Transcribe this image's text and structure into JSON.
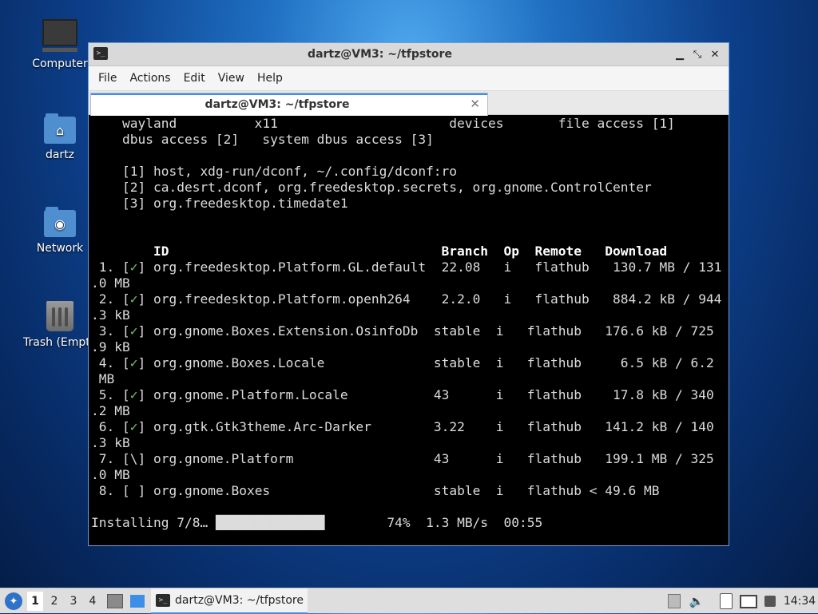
{
  "desktop": {
    "icons": [
      {
        "label": "Computer"
      },
      {
        "label": "dartz"
      },
      {
        "label": "Network"
      },
      {
        "label": "Trash (Empty)"
      }
    ]
  },
  "window": {
    "title": "dartz@VM3: ~/tfpstore",
    "controls": {
      "minimize": "▁",
      "maximize": "⤡",
      "close": "✕"
    },
    "menu": [
      "File",
      "Actions",
      "Edit",
      "View",
      "Help"
    ],
    "tab": {
      "label": "dartz@VM3: ~/tfpstore",
      "close": "✕"
    }
  },
  "terminal": {
    "permissions": [
      "    wayland          x11                      devices       file access [1]",
      "    dbus access [2]   system dbus access [3]"
    ],
    "notes": [
      "    [1] host, xdg-run/dconf, ~/.config/dconf:ro",
      "    [2] ca.desrt.dconf, org.freedesktop.secrets, org.gnome.ControlCenter",
      "    [3] org.freedesktop.timedate1"
    ],
    "header": "        ID                                   Branch  Op  Remote   Download",
    "rows": [
      {
        "num": " 1.",
        "mark": "✓",
        "rest": " org.freedesktop.Platform.GL.default  22.08   i   flathub   130.7 MB / 131",
        "wrap": ".0 MB"
      },
      {
        "num": " 2.",
        "mark": "✓",
        "rest": " org.freedesktop.Platform.openh264    2.2.0   i   flathub   884.2 kB / 944",
        "wrap": ".3 kB"
      },
      {
        "num": " 3.",
        "mark": "✓",
        "rest": " org.gnome.Boxes.Extension.OsinfoDb  stable  i   flathub   176.6 kB / 725",
        "wrap": ".9 kB"
      },
      {
        "num": " 4.",
        "mark": "✓",
        "rest": " org.gnome.Boxes.Locale              stable  i   flathub     6.5 kB / 6.2",
        "wrap": " MB"
      },
      {
        "num": " 5.",
        "mark": "✓",
        "rest": " org.gnome.Platform.Locale           43      i   flathub    17.8 kB / 340",
        "wrap": ".2 MB"
      },
      {
        "num": " 6.",
        "mark": "✓",
        "rest": " org.gtk.Gtk3theme.Arc-Darker        3.22    i   flathub   141.2 kB / 140",
        "wrap": ".3 kB"
      },
      {
        "num": " 7.",
        "mark": "\\",
        "rest": " org.gnome.Platform                  43      i   flathub   199.1 MB / 325",
        "wrap": ".0 MB"
      },
      {
        "num": " 8.",
        "mark": " ",
        "rest": " org.gnome.Boxes                     stable  i   flathub < 49.6 MB",
        "wrap": ""
      }
    ],
    "status_prefix": "Installing 7/8… ",
    "status_bar": "██████████████",
    "status_suffix": "        74%  1.3 MB/s  00:55"
  },
  "taskbar": {
    "workspaces": [
      "1",
      "2",
      "3",
      "4"
    ],
    "task_label": "dartz@VM3: ~/tfpstore",
    "clock": "14:34"
  }
}
